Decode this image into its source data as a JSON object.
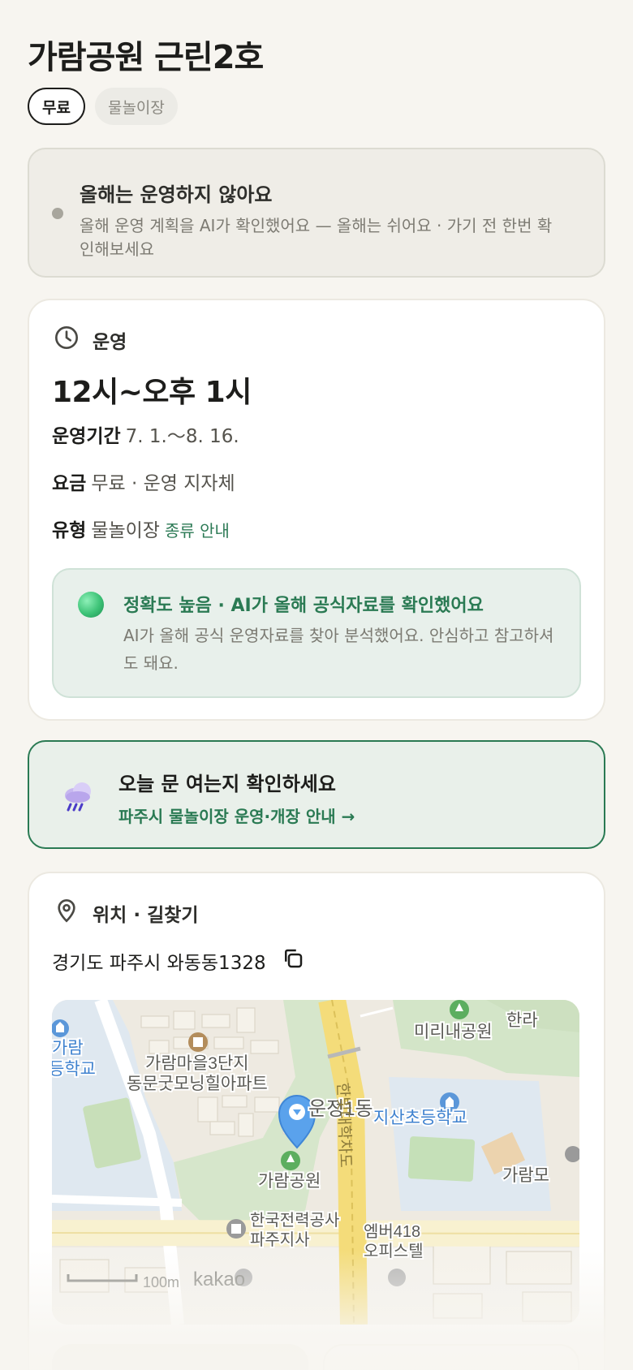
{
  "header": {
    "title": "가람공원 근린2호"
  },
  "chips": [
    {
      "label": "무료"
    },
    {
      "label": "물놀이장"
    }
  ],
  "notice": {
    "title": "올해는 운영하지 않아요",
    "description": "올해 운영 계획을 AI가 확인했어요 — 올해는 쉬어요 · 가기 전 한번 확인해보세요"
  },
  "hours_card": {
    "section_label": "운영",
    "hours": "12시~오후 1시",
    "period_label": "운영기간",
    "period_value": "7. 1.～8. 16.",
    "fee_label": "요금",
    "fee_value": "무료 · 운영 지자체",
    "type_label": "유형",
    "type_value": "물놀이장",
    "type_link": "종류 안내",
    "accuracy": {
      "title": "정확도 높음 · AI가 올해 공식자료를 확인했어요",
      "description": "AI가 올해 공식 운영자료를 찾아 분석했어요. 안심하고 참고하셔도 돼요."
    }
  },
  "weather_banner": {
    "title": "오늘 문 여는지 확인하세요",
    "link": "파주시 물놀이장 운영·개장 안내 →"
  },
  "location_card": {
    "section_label": "위치 · 길찾기",
    "address": "경기도 파주시 와동동1328",
    "map": {
      "labels": {
        "park_main": "가람공원",
        "park_north": "미리내공원",
        "apartment_line1": "가람마을3단지",
        "apartment_line2": "동문굿모닝힐아파트",
        "school_west_line1": "가람",
        "school_west_line2": "등학교",
        "school_east": "지산초등학교",
        "district": "운정1동",
        "road": "한빛대학차도",
        "kepco_line1": "한국전력공사",
        "kepco_line2": "파주지사",
        "officetel_line1": "엠버418",
        "officetel_line2": "오피스텔",
        "edge_top_right": "한라",
        "edge_right": "가람모",
        "scale": "100m",
        "brand": "kakao"
      }
    }
  }
}
